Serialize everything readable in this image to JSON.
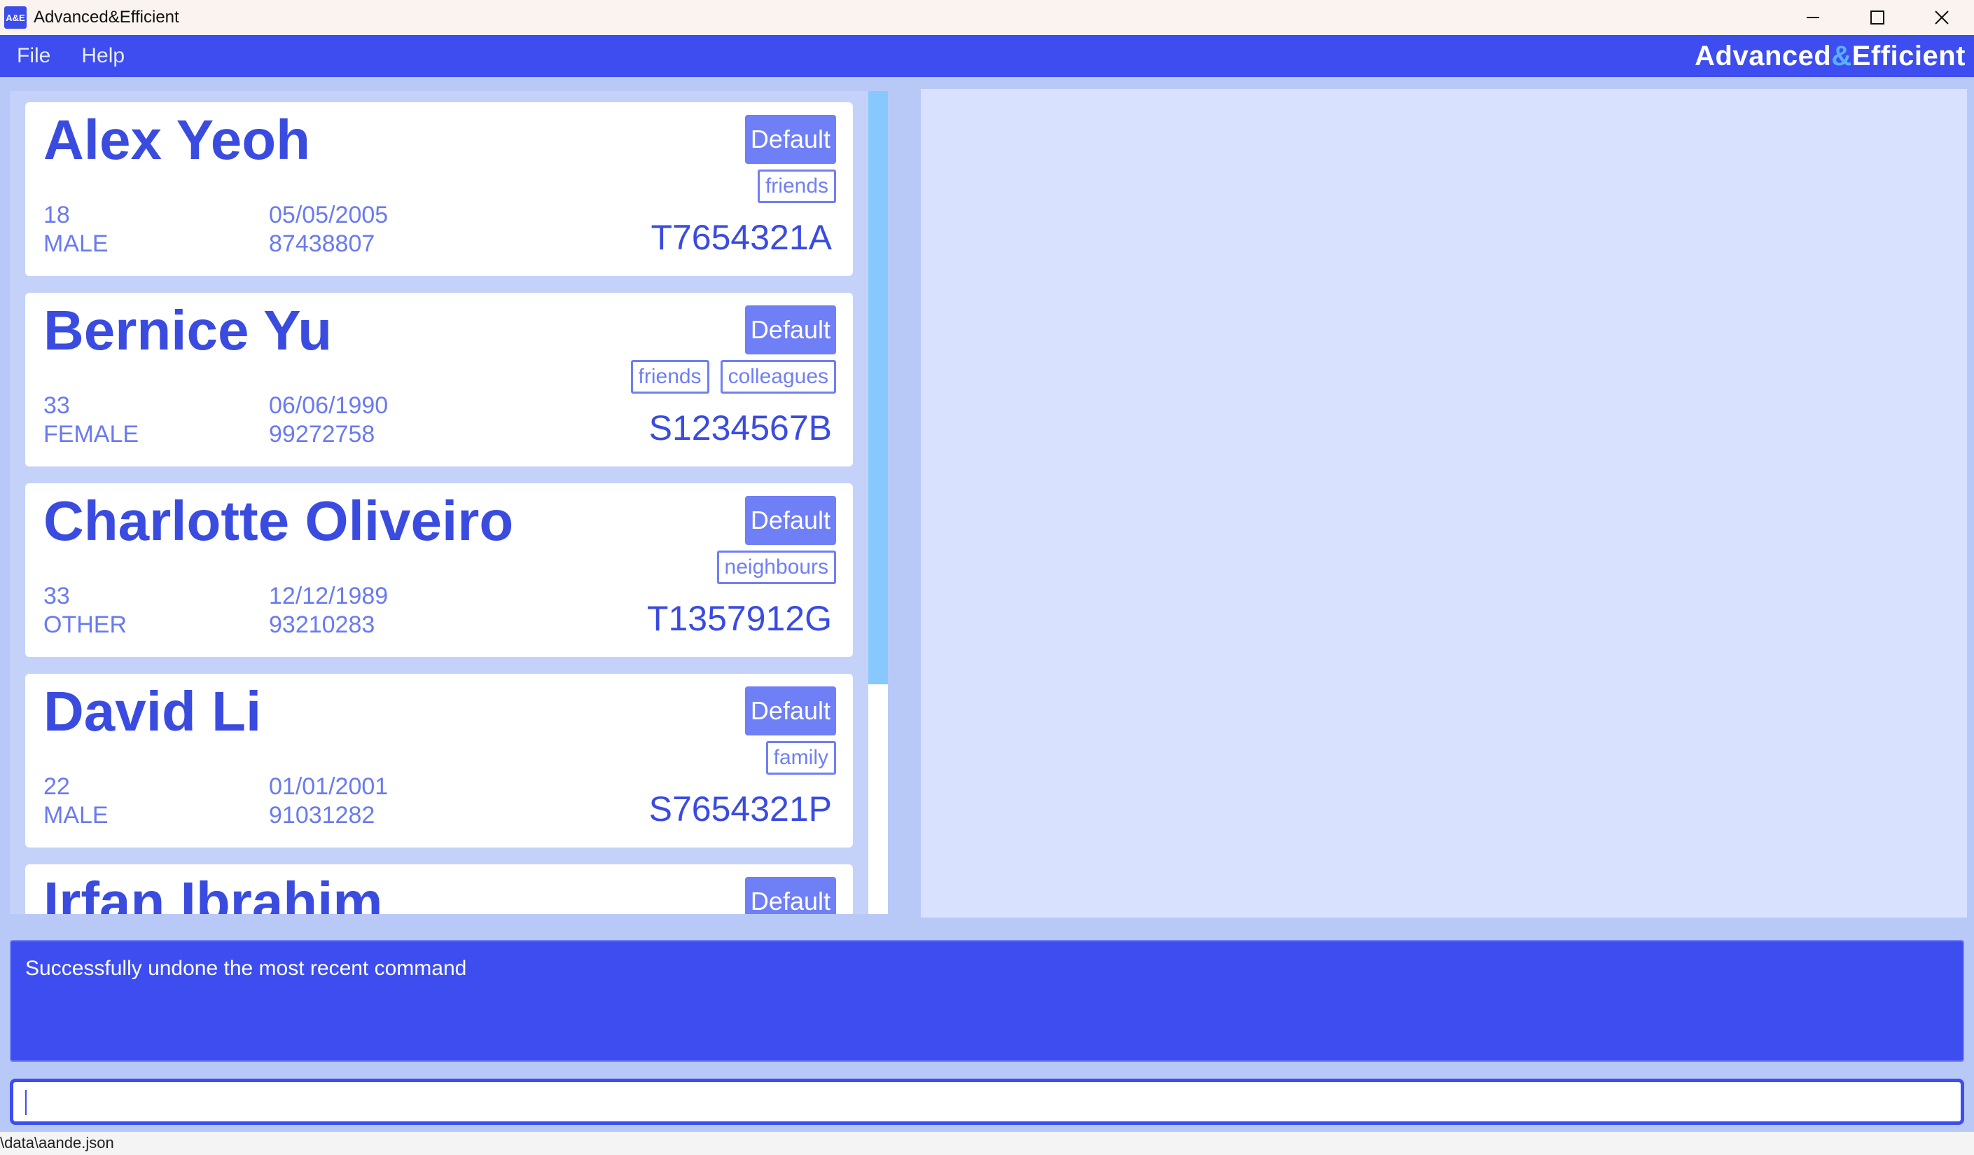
{
  "window": {
    "icon_text": "A&E",
    "title": "Advanced&Efficient",
    "controls": [
      "minimize",
      "maximize",
      "close"
    ]
  },
  "menubar": {
    "items": [
      "File",
      "Help"
    ],
    "brand_part1": "Advanced",
    "brand_amp": "&",
    "brand_part2": "Efficient"
  },
  "persons": [
    {
      "name": "Alex Yeoh",
      "age": "18",
      "gender": "MALE",
      "dob": "05/05/2005",
      "phone": "87438807",
      "nric": "T7654321A",
      "priority": "Default",
      "tags": [
        "friends"
      ]
    },
    {
      "name": "Bernice Yu",
      "age": "33",
      "gender": "FEMALE",
      "dob": "06/06/1990",
      "phone": "99272758",
      "nric": "S1234567B",
      "priority": "Default",
      "tags": [
        "friends",
        "colleagues"
      ]
    },
    {
      "name": "Charlotte Oliveiro",
      "age": "33",
      "gender": "OTHER",
      "dob": "12/12/1989",
      "phone": "93210283",
      "nric": "T1357912G",
      "priority": "Default",
      "tags": [
        "neighbours"
      ]
    },
    {
      "name": "David Li",
      "age": "22",
      "gender": "MALE",
      "dob": "01/01/2001",
      "phone": "91031282",
      "nric": "S7654321P",
      "priority": "Default",
      "tags": [
        "family"
      ]
    },
    {
      "name": "Irfan Ibrahim",
      "priority": "Default"
    }
  ],
  "result": {
    "message": "Successfully undone the most recent command"
  },
  "command": {
    "value": ""
  },
  "status": {
    "path": "\\data\\aande.json"
  },
  "colors": {
    "primary": "#3d4df0",
    "accent_light": "#6f7ff5",
    "list_bg": "#c4d2fa",
    "detail_bg": "#d8e2fe",
    "scroll_thumb": "#86c8ff"
  }
}
